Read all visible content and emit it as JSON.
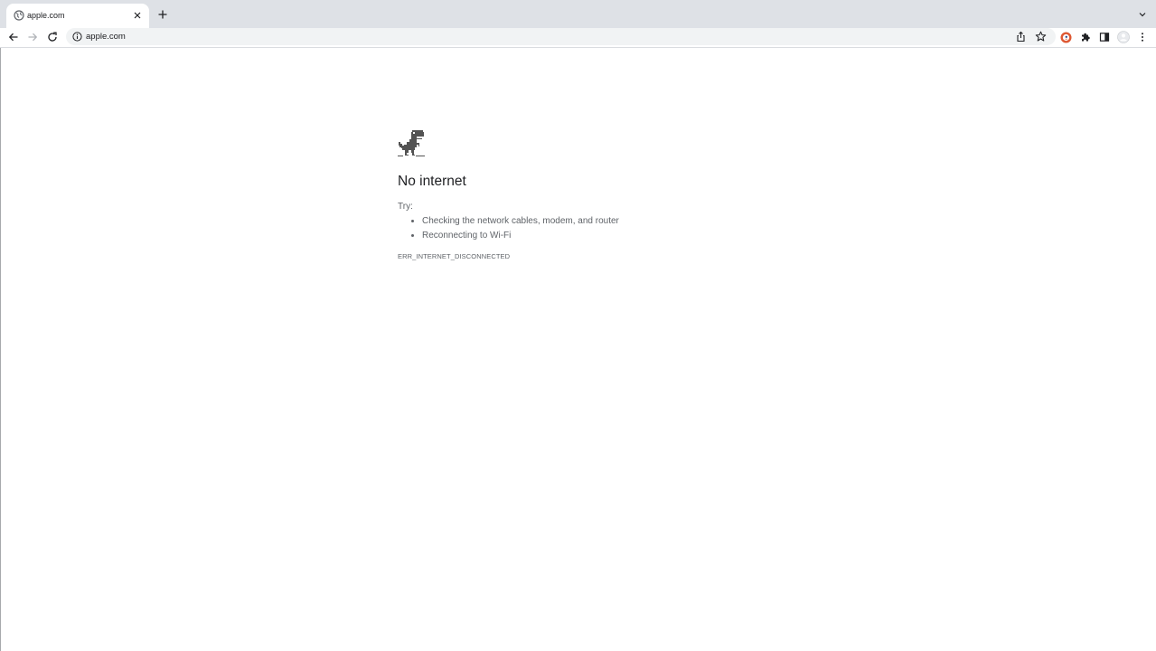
{
  "tab": {
    "title": "apple.com"
  },
  "omnibox": {
    "url": "apple.com"
  },
  "error_page": {
    "heading": "No internet",
    "try_label": "Try:",
    "suggestions": [
      "Checking the network cables, modem, and router",
      "Reconnecting to Wi-Fi"
    ],
    "error_code": "ERR_INTERNET_DISCONNECTED"
  },
  "icons": {
    "favicon": "globe-icon",
    "tab_close": "close-icon",
    "new_tab": "plus-icon",
    "tab_search": "chevron-down-icon",
    "back": "arrow-left-icon",
    "forward": "arrow-right-icon",
    "reload": "reload-icon",
    "site_info": "info-icon",
    "share": "share-icon",
    "bookmark": "star-icon",
    "duckduckgo_extension": "duckduckgo-icon",
    "extensions": "puzzle-icon",
    "side_panel": "side-panel-icon",
    "profile": "avatar-icon",
    "menu": "kebab-menu-icon",
    "dino": "dinosaur-icon"
  },
  "colors": {
    "tabstrip_bg": "#dee1e6",
    "omnibox_bg": "#f1f3f4",
    "text_primary": "#202124",
    "text_secondary": "#5f6368",
    "duckduckgo_orange": "#de5833"
  }
}
